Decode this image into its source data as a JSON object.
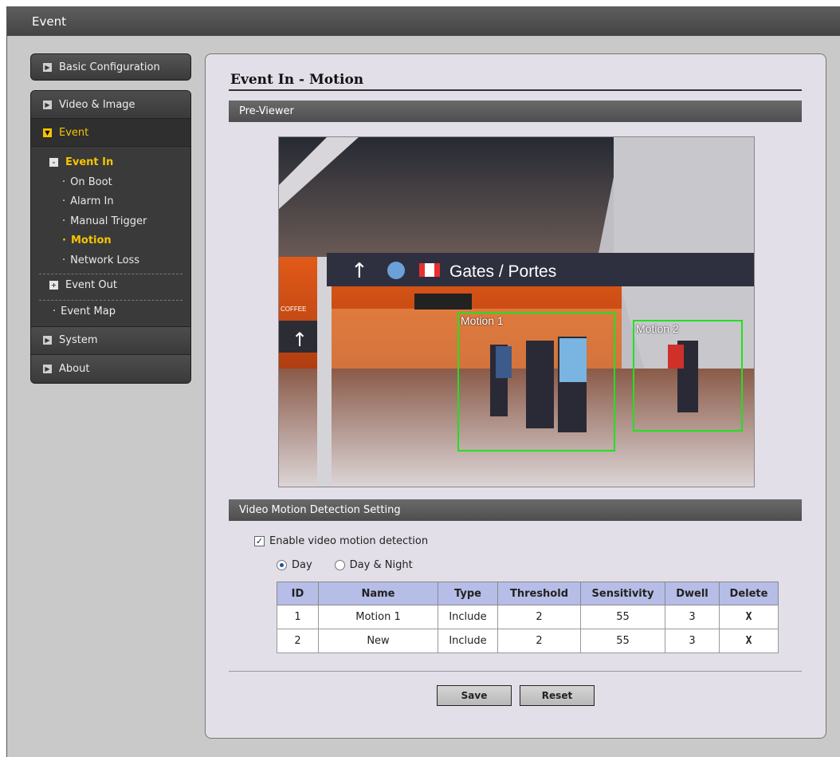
{
  "window": {
    "title": "Event"
  },
  "sidebar": {
    "basic": "Basic Configuration",
    "items": [
      {
        "label": "Video & Image"
      },
      {
        "label": "Event"
      },
      {
        "label": "System"
      },
      {
        "label": "About"
      }
    ],
    "event_in": {
      "label": "Event In",
      "items": [
        "On Boot",
        "Alarm In",
        "Manual Trigger",
        "Motion",
        "Network Loss"
      ],
      "selected": "Motion"
    },
    "event_out": "Event Out",
    "event_map": "Event Map",
    "icon_collapsed": "+",
    "icon_expanded": "-"
  },
  "main": {
    "title": "Event In - Motion",
    "previewer": "Pre-Viewer",
    "viewer": {
      "sign_text": "Gates / Portes",
      "sign_small": "COFFEE",
      "motion_labels": [
        "Motion 1",
        "Motion 2"
      ]
    },
    "vmd_section": "Video Motion Detection Setting",
    "enable_label": "Enable video motion detection",
    "enable_checked": true,
    "mode_options": [
      "Day",
      "Day & Night"
    ],
    "mode_selected": "Day",
    "table": {
      "headers": [
        "ID",
        "Name",
        "Type",
        "Threshold",
        "Sensitivity",
        "Dwell",
        "Delete"
      ],
      "rows": [
        [
          "1",
          "Motion 1",
          "Include",
          "2",
          "55",
          "3",
          "X"
        ],
        [
          "2",
          "New",
          "Include",
          "2",
          "55",
          "3",
          "X"
        ]
      ]
    },
    "save_label": "Save",
    "reset_label": "Reset"
  },
  "colors": {
    "accent": "#f5c400",
    "table_header": "#b6bde7",
    "motion_box": "#22e022"
  }
}
